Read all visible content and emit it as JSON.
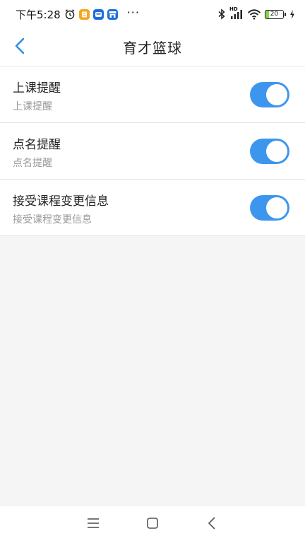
{
  "status_bar": {
    "time": "下午5:28",
    "more": "···",
    "network_badge": "HD",
    "battery_level": "20",
    "icons": [
      "alarm-icon",
      "notes-app-icon",
      "message-app-icon",
      "store-app-icon",
      "bluetooth-icon",
      "signal-icon",
      "wifi-icon",
      "battery-icon",
      "charging-icon"
    ],
    "colors": {
      "notes": "#f5a623",
      "message": "#1e6fd9",
      "store": "#1e6fd9"
    }
  },
  "nav": {
    "title": "育才篮球",
    "back_icon": "chevron-left-icon"
  },
  "settings": [
    {
      "title": "上课提醒",
      "subtitle": "上课提醒",
      "enabled": true
    },
    {
      "title": "点名提醒",
      "subtitle": "点名提醒",
      "enabled": true
    },
    {
      "title": "接受课程变更信息",
      "subtitle": "接受课程变更信息",
      "enabled": true
    }
  ],
  "system_nav": {
    "icons": [
      "menu-icon",
      "home-icon",
      "back-icon"
    ]
  },
  "theme": {
    "accent": "#3d96ee",
    "background": "#f5f5f5"
  }
}
